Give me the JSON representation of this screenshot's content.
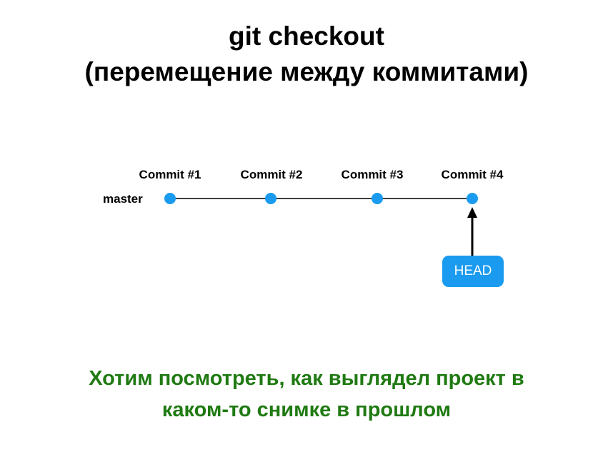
{
  "title": {
    "line1": "git checkout",
    "line2": "(перемещение между коммитами)"
  },
  "branch": {
    "label": "master"
  },
  "commits": [
    {
      "label": "Commit #1"
    },
    {
      "label": "Commit #2"
    },
    {
      "label": "Commit #3"
    },
    {
      "label": "Commit #4"
    }
  ],
  "head": {
    "label": "HEAD",
    "points_to_commit_index": 3
  },
  "caption": {
    "line1": "Хотим посмотреть, как выглядел проект в",
    "line2": "каком-то снимке в прошлом"
  },
  "colors": {
    "commit_dot": "#1a9bf0",
    "head_badge": "#1a9bf0",
    "caption_text": "#1f7a12",
    "line": "#000000"
  }
}
